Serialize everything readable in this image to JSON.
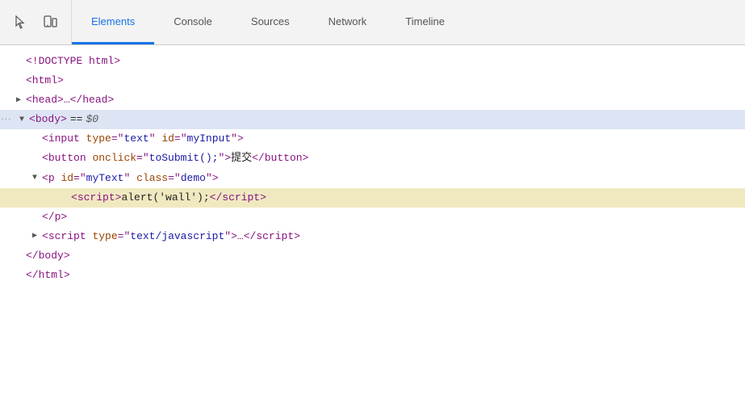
{
  "toolbar": {
    "tabs": [
      {
        "id": "pointer-icon",
        "type": "icon"
      },
      {
        "id": "device-icon",
        "type": "icon"
      },
      {
        "label": "Elements",
        "active": true
      },
      {
        "label": "Console",
        "active": false
      },
      {
        "label": "Sources",
        "active": false
      },
      {
        "label": "Network",
        "active": false
      },
      {
        "label": "Timeline",
        "active": false
      }
    ]
  },
  "code_lines": [
    {
      "id": "doctype",
      "indent": 0,
      "text": "<!DOCTYPE html>"
    },
    {
      "id": "html-open",
      "indent": 0,
      "text": "<html>"
    },
    {
      "id": "head",
      "indent": 0,
      "collapsed": true,
      "text": "<head>…</head>"
    },
    {
      "id": "body-selected",
      "indent": 0,
      "collapsed": false,
      "selected": true,
      "text": "<body> == $0"
    },
    {
      "id": "input-line",
      "indent": 1,
      "text": "<input type=\"text\" id=\"myInput\">"
    },
    {
      "id": "button-line",
      "indent": 1,
      "text": "<button onclick=\"toSubmit();\">提交</button>"
    },
    {
      "id": "p-open",
      "indent": 1,
      "collapsed": false,
      "text": "<p id=\"myText\" class=\"demo\">"
    },
    {
      "id": "script-inline",
      "indent": 2,
      "highlighted": true,
      "text": "<script>alert('wall');<\\/script>"
    },
    {
      "id": "p-close",
      "indent": 1,
      "text": "</p>"
    },
    {
      "id": "script-external",
      "indent": 1,
      "collapsed": true,
      "text": "<script type=\"text/javascript\">…<\\/script>"
    },
    {
      "id": "body-close",
      "indent": 0,
      "text": "</body>"
    },
    {
      "id": "html-close",
      "indent": 0,
      "text": "</html>"
    }
  ],
  "colors": {
    "tab_active": "#1a73e8",
    "highlight_yellow": "#f5e55b",
    "selected_bg": "#dde5f4"
  }
}
